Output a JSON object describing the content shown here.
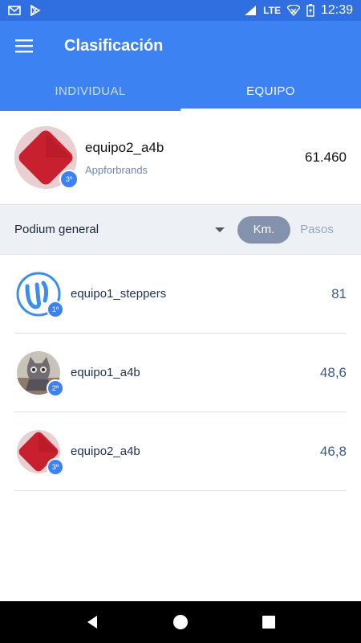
{
  "status_bar": {
    "time": "12:39",
    "network": "LTE",
    "icons": [
      "gmail-icon",
      "play-store-icon",
      "signal-icon",
      "wifi-icon",
      "battery-charging-icon"
    ]
  },
  "app_bar": {
    "title": "Clasificación",
    "menu_icon": "hamburger-menu-icon"
  },
  "tabs": [
    {
      "label": "INDIVIDUAL",
      "active": false
    },
    {
      "label": "EQUIPO",
      "active": true
    }
  ],
  "top_team": {
    "name": "equipo2_a4b",
    "company": "Appforbrands",
    "rank": "3º",
    "score": "61.460"
  },
  "filter": {
    "selected": "Podium general",
    "toggle_options": [
      {
        "label": "Km.",
        "active": true
      },
      {
        "label": "Pasos",
        "active": false
      }
    ]
  },
  "ranking": [
    {
      "name": "equipo1_steppers",
      "rank": "1º",
      "value": "81",
      "avatar": "steppers-logo-icon"
    },
    {
      "name": "equipo1_a4b",
      "rank": "2º",
      "value": "48,6",
      "avatar": "cat-photo-avatar"
    },
    {
      "name": "equipo2_a4b",
      "rank": "3º",
      "value": "46,8",
      "avatar": "red-diamond-logo-icon"
    }
  ],
  "colors": {
    "primary": "#3d82f3",
    "status_bar": "#2f6fe0",
    "filter_bg": "#edf0f5",
    "toggle_active": "#8592ad",
    "value_text": "#3f5a86",
    "logo_red": "#c8202e"
  },
  "nav_bar": {
    "icons": [
      "back-icon",
      "home-icon",
      "recents-icon"
    ]
  }
}
